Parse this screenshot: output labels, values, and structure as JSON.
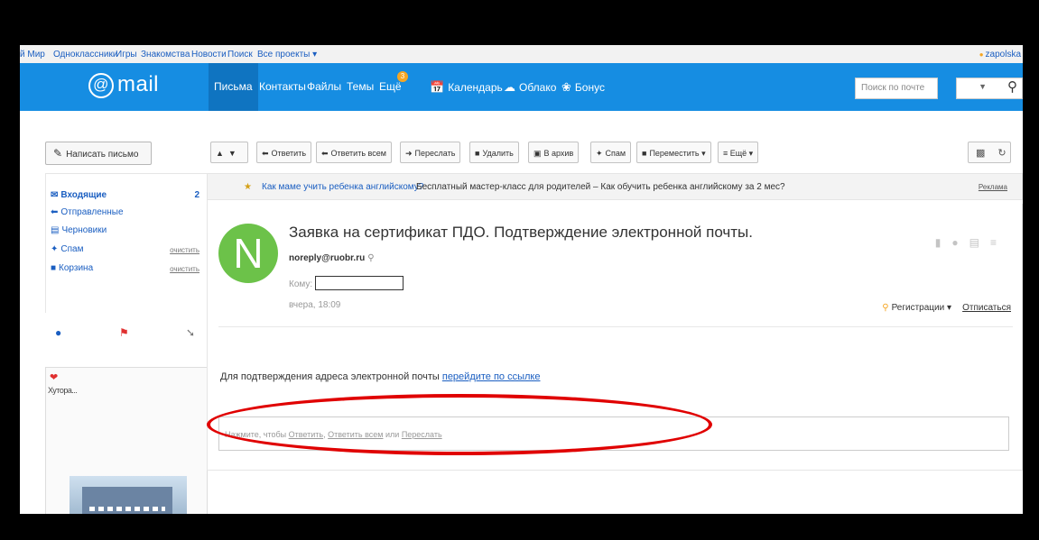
{
  "portal": {
    "links": [
      "й Мир",
      "Одноклассники",
      "Игры",
      "Знакомства",
      "Новости",
      "Поиск",
      "Все проекты ▾"
    ],
    "user": "zapolska"
  },
  "header": {
    "logo": "mail",
    "nav": [
      {
        "label": "Письма",
        "active": true
      },
      {
        "label": "Контакты"
      },
      {
        "label": "Файлы"
      },
      {
        "label": "Темы"
      },
      {
        "label": "Ещё",
        "badge": "3"
      },
      {
        "label": "Календарь",
        "icon": "calendar-icon"
      },
      {
        "label": "Облако",
        "icon": "cloud-icon"
      },
      {
        "label": "Бонус",
        "icon": "bonus-icon"
      }
    ],
    "search_placeholder": "Поиск по почте"
  },
  "compose_label": "Написать письмо",
  "toolbar": {
    "reply": "Ответить",
    "reply_all": "Ответить всем",
    "forward": "Переслать",
    "delete": "Удалить",
    "archive": "В архив",
    "spam": "Спам",
    "move": "Переместить ▾",
    "more": "≡ Ещё ▾"
  },
  "sidebar": {
    "folders": [
      {
        "label": "Входящие",
        "count": "2"
      },
      {
        "label": "Отправленные"
      },
      {
        "label": "Черновики"
      },
      {
        "label": "Спам",
        "clean": "очистить"
      },
      {
        "label": "Корзина",
        "clean": "очистить"
      }
    ],
    "ad_text": "Хутора... "
  },
  "promo": {
    "link": "Как маме учить ребенка английскому?",
    "text": "Бесплатный мастер-класс для родителей – Как обучить ребенка английскому за 2 мес?",
    "ad_label": "Реклама"
  },
  "message": {
    "avatar_letter": "N",
    "subject": "Заявка на сертификат ПДО. Подтверждение электронной почты.",
    "sender": "noreply@ruobr.ru",
    "to_label": "Кому:",
    "date": "вчера, 18:09",
    "registration": "Регистрации ▾",
    "unsubscribe": "Отписаться",
    "body_text": "Для подтверждения адреса электронной почты",
    "body_link": "перейдите по ссылке",
    "reply_prompt": "Нажмите, чтобы",
    "reply_opt1": "Ответить",
    "reply_opt2": "Ответить всем",
    "reply_or": "или",
    "reply_opt3": "Переслать"
  },
  "colors": {
    "header_blue": "#168de2",
    "avatar_green": "#6cc249",
    "annotation_red": "#e00000",
    "link_blue": "#1a5ec1"
  }
}
